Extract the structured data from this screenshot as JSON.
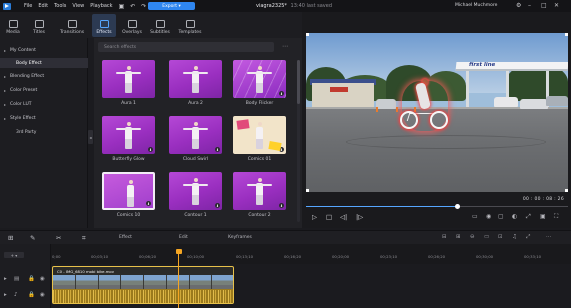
{
  "menubar": {
    "menus": [
      "File",
      "Edit",
      "Tools",
      "View",
      "Playback"
    ],
    "export_label": "Export ▾",
    "doc_title": "viagra2325*",
    "doc_status": "13:40 last saved",
    "user": "Michael Muchmore"
  },
  "tabs": [
    {
      "label": "Media",
      "name": "tab-media"
    },
    {
      "label": "Titles",
      "name": "tab-titles"
    },
    {
      "label": "Transitions",
      "name": "tab-transitions"
    },
    {
      "label": "Effects",
      "name": "tab-effects"
    },
    {
      "label": "Overlays",
      "name": "tab-overlays"
    },
    {
      "label": "Subtitles",
      "name": "tab-subtitles"
    },
    {
      "label": "Templates",
      "name": "tab-templates"
    }
  ],
  "categories": [
    {
      "label": "My Content",
      "arrow": "▸"
    },
    {
      "label": "Body Effect",
      "arrow": ""
    },
    {
      "label": "Blending Effect",
      "arrow": "▸"
    },
    {
      "label": "Color Preset",
      "arrow": "▸"
    },
    {
      "label": "Color LUT",
      "arrow": "▸"
    },
    {
      "label": "Style Effect",
      "arrow": "▸"
    },
    {
      "label": "3rd Party",
      "arrow": ""
    }
  ],
  "search": {
    "placeholder": "Search effects"
  },
  "effects": [
    {
      "label": "Aura 1",
      "style": "plain"
    },
    {
      "label": "Aura 2",
      "style": "plain"
    },
    {
      "label": "Body Flicker",
      "style": "flicker"
    },
    {
      "label": "Butterfly Glow",
      "style": "plain"
    },
    {
      "label": "Cloud Swirl",
      "style": "plain"
    },
    {
      "label": "Comics 01",
      "style": "comics"
    },
    {
      "label": "Comics 10",
      "style": "comics10"
    },
    {
      "label": "Contour 1",
      "style": "plain"
    },
    {
      "label": "Contour 2",
      "style": "plain"
    }
  ],
  "preview": {
    "sign_text": "first line",
    "timecode": "00 : 00 : 08 : 26",
    "progress_fraction": 0.58
  },
  "timeline": {
    "tabs": [
      "Effect",
      "Edit",
      "Keyframes"
    ],
    "ruler": [
      "0;00",
      "00;03;10",
      "00;06;20",
      "00;10;00",
      "00;13;10",
      "00;16;20",
      "00;20;00",
      "00;23;10",
      "00;26;20",
      "00;30;00",
      "00;33;10"
    ],
    "add_track": "+ ▾",
    "clip_title": "C0 - IMG_6810 mobi bike.mov"
  }
}
